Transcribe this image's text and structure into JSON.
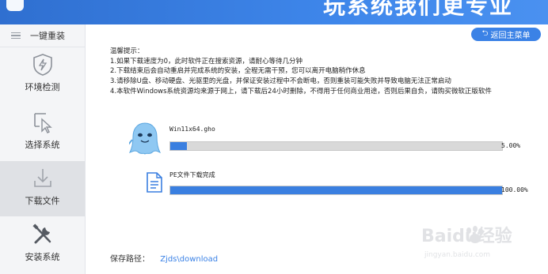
{
  "header": {
    "slogan": "玩系统我们更专业"
  },
  "sidebar": {
    "head_label": "一键重装",
    "items": [
      {
        "label": "环境检测",
        "icon": "shield-bolt-icon"
      },
      {
        "label": "选择系统",
        "icon": "cursor-select-icon"
      },
      {
        "label": "下载文件",
        "icon": "download-icon"
      },
      {
        "label": "安装系统",
        "icon": "tools-icon"
      }
    ],
    "active_index": 2
  },
  "main": {
    "back_button": "返回主菜单",
    "tips": [
      "温馨提示：",
      "1.如果下载速度为0，此时软件正在搜索资源，请耐心等待几分钟",
      "2.下载结束后会自动重启并完成系统的安装，全程无需干预，您可以离开电脑稍作休息",
      "3.请移除U盘、移动硬盘、光驱里的光盘，并保证安装过程中不会断电，否则重装可能失败并导致电脑无法正常启动",
      "4.本软件Windows系统资源均来源于网上，请下载后24小时删除，不得用于任何商业用途，否则后果自负，请购买微软正版软件"
    ],
    "tasks": [
      {
        "name": "Win11x64.gho",
        "percent_text": "5.00%",
        "progress": 0.05,
        "icon": "ghost-mascot-icon"
      },
      {
        "name": "PE文件下载完成",
        "percent_text": "100.00%",
        "progress": 1.0,
        "icon": "document-icon"
      }
    ],
    "save_path_label": "保存路径：",
    "save_path_value": "Zjds\\download"
  },
  "watermark": {
    "text": "Baidu经验",
    "subtext": "jingyan.baidu.com"
  },
  "colors": {
    "accent": "#3b82e6",
    "progress": "#3a7fe0",
    "topbar": "#3e86ea"
  }
}
